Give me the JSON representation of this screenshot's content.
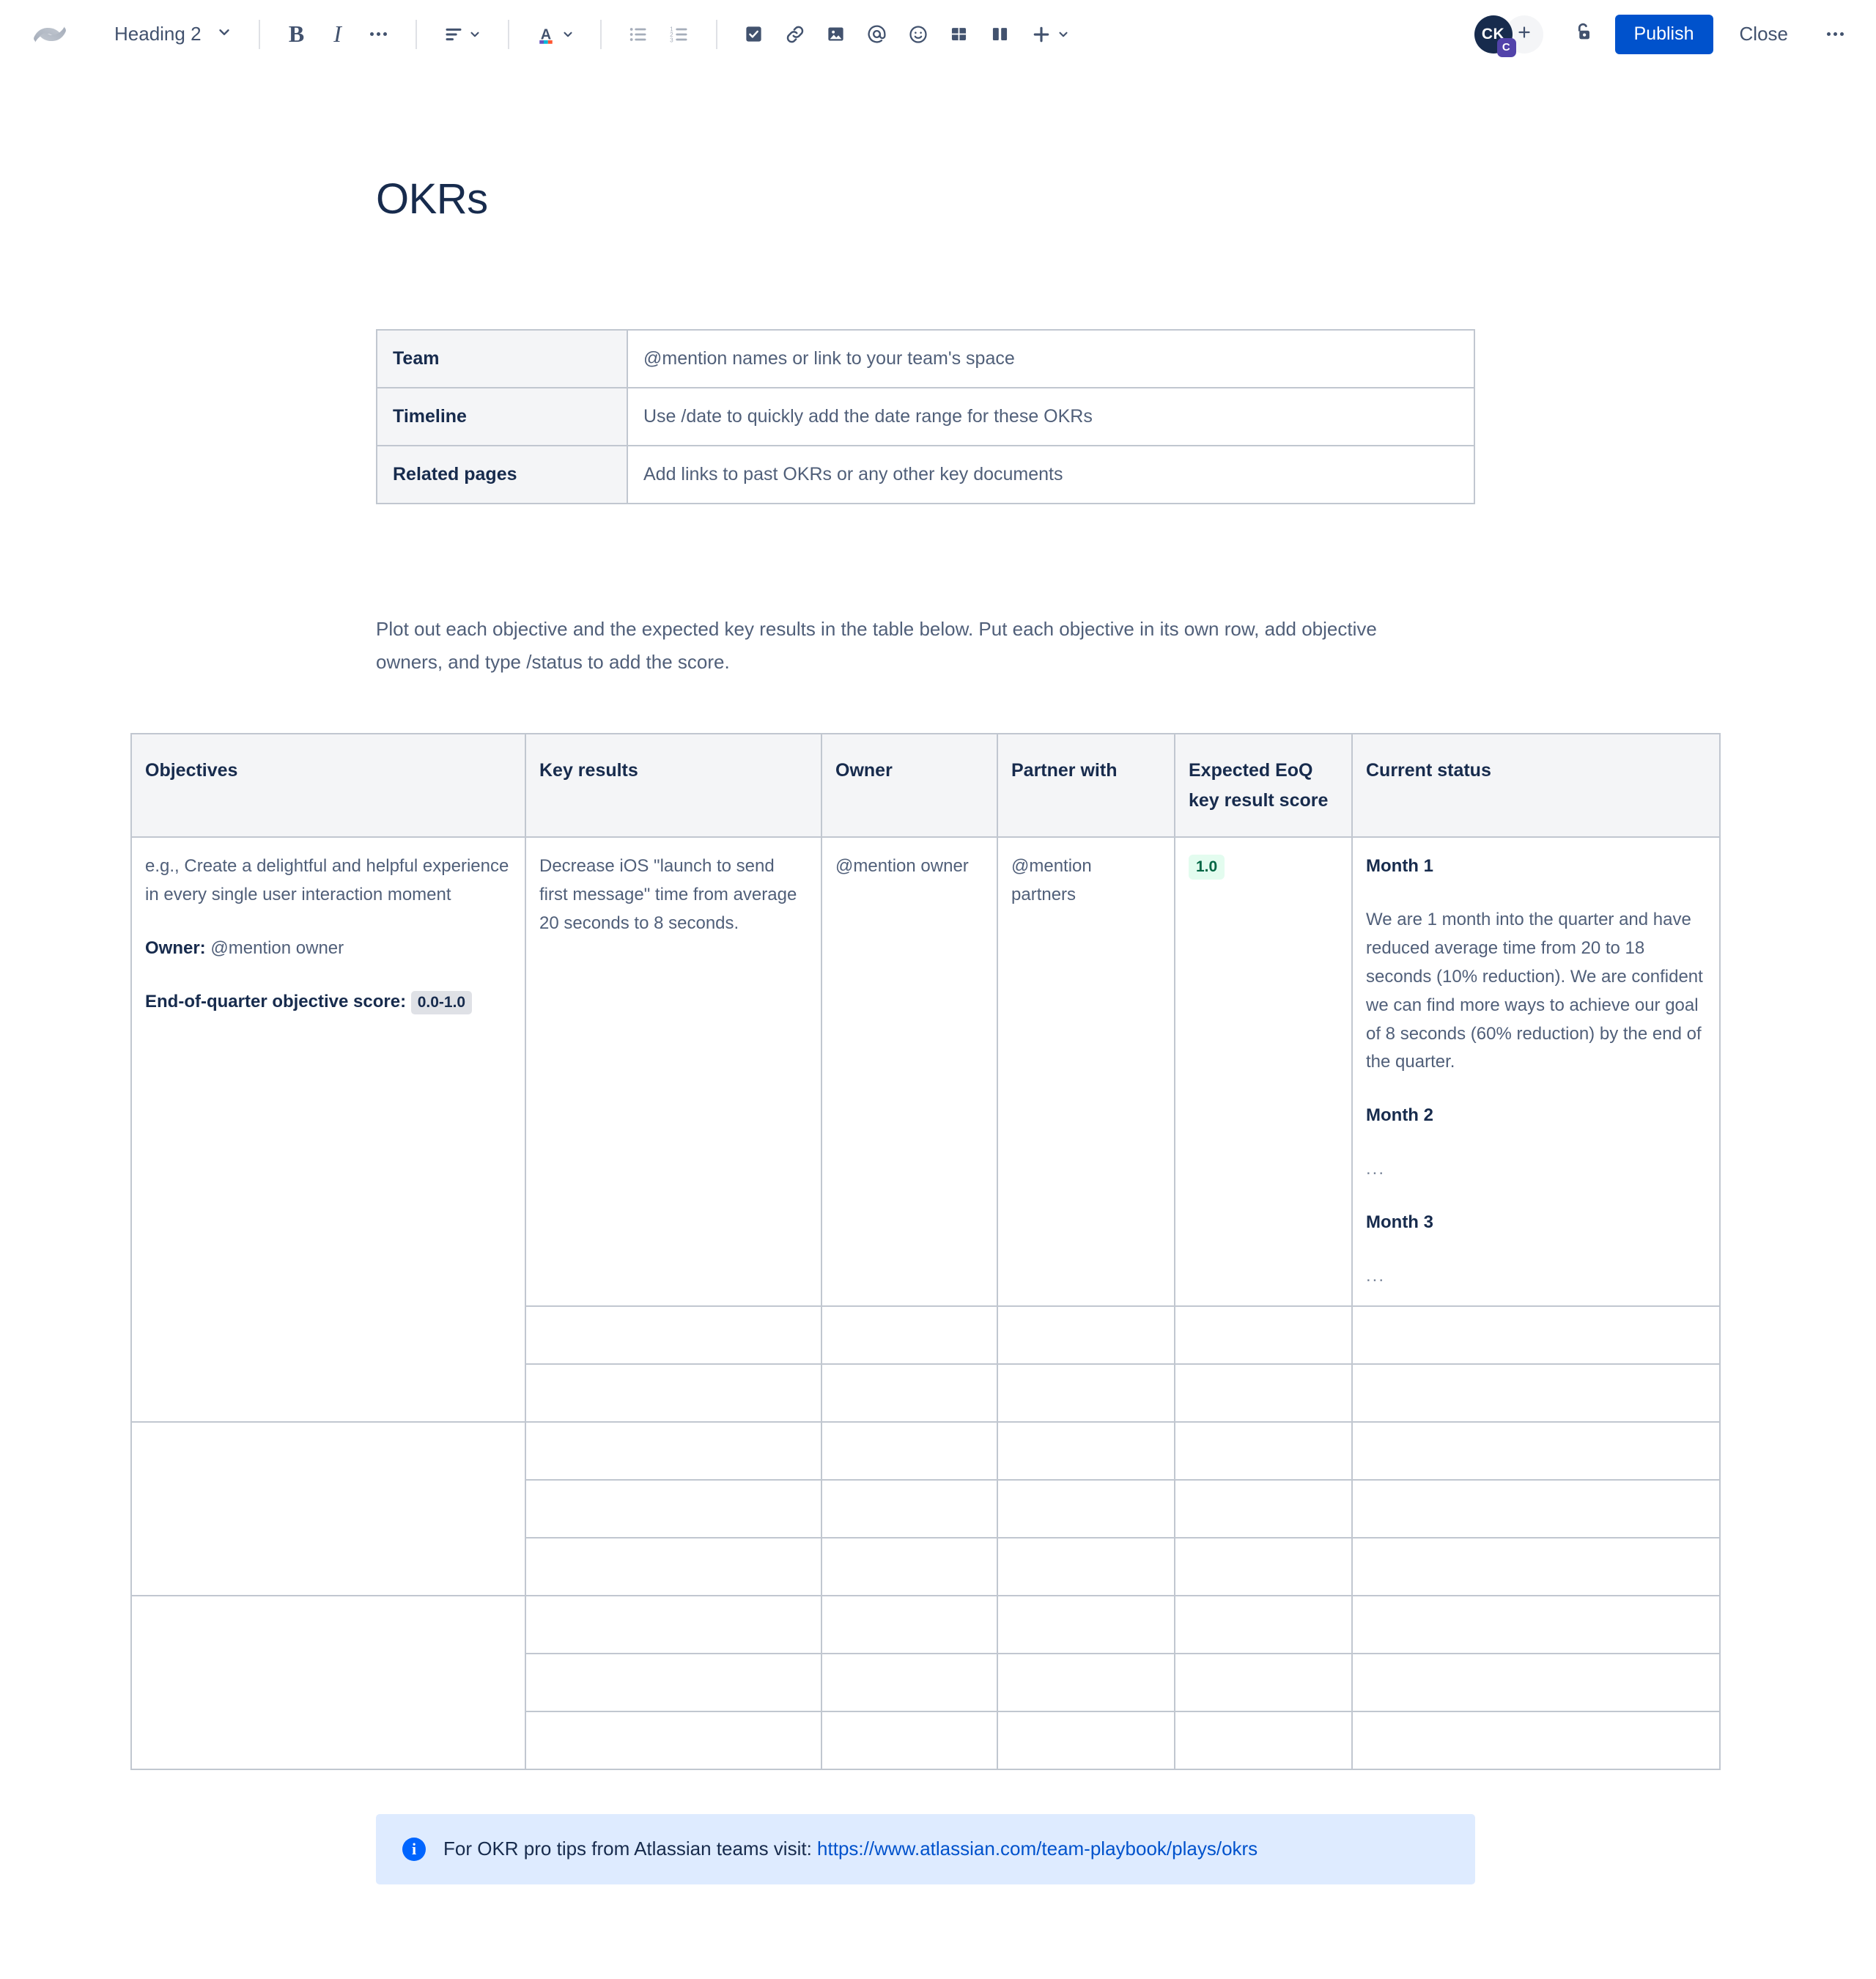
{
  "toolbar": {
    "logo_icon": "confluence-logo-icon",
    "block_type": {
      "label": "Heading 2",
      "chevron_icon": "chevron-down-icon"
    },
    "bold": {
      "label": "B",
      "name": "bold-button"
    },
    "italic": {
      "label": "I",
      "name": "italic-button"
    },
    "more_formatting_icon": "ellipsis-horizontal-icon",
    "align_icon": "text-align-left-icon",
    "text_color_icon": "text-color-a-icon",
    "bullet_list_icon": "bullet-list-icon",
    "numbered_list_icon": "numbered-list-icon",
    "task_icon": "checkbox-task-icon",
    "link_icon": "link-chain-icon",
    "image_icon": "image-picture-icon",
    "mention_icon": "at-mention-icon",
    "emoji_icon": "emoji-smiley-icon",
    "table_icon": "table-grid-icon",
    "layout_icon": "page-layout-columns-icon",
    "insert_icon": "plus-icon",
    "insert_chevron_icon": "chevron-down-icon",
    "avatar": {
      "initials": "CK",
      "badge": "C",
      "name": "user-avatar"
    },
    "add_collaborator_icon": "plus-icon",
    "restrictions_icon": "unlocked-padlock-icon",
    "publish_label": "Publish",
    "close_label": "Close",
    "more_actions_icon": "ellipsis-horizontal-icon"
  },
  "document": {
    "title": "OKRs",
    "meta_table": {
      "rows": [
        {
          "label": "Team",
          "value": "@mention names or link to your team's space"
        },
        {
          "label": "Timeline",
          "value": "Use /date to quickly add the date range for these OKRs"
        },
        {
          "label": "Related pages",
          "value": "Add links to past OKRs or any other key documents"
        }
      ]
    },
    "intro_paragraph": "Plot out each objective and the expected key results in the table below. Put each objective in its own row, add objective owners, and type /status to add the score.",
    "okr_table": {
      "headers": [
        "Objectives",
        "Key results",
        "Owner",
        "Partner with",
        "Expected EoQ key result score",
        "Current status"
      ],
      "row1": {
        "objective_text": "e.g., Create a delightful and helpful experience in every single user interaction moment",
        "owner_label": "Owner:",
        "owner_value": "@mention owner",
        "score_label": "End-of-quarter objective score:",
        "score_range_chip": "0.0-1.0",
        "key_result": "Decrease iOS \"launch to send first message\" time from average 20 seconds to 8 seconds.",
        "owner": "@mention owner",
        "partner_with": "@mention partners",
        "expected_score_chip": "1.0",
        "status": {
          "month1_heading": "Month 1",
          "month1_body": "We are 1 month into the quarter and have reduced average time from 20 to 18 seconds (10% reduction). We are confident we can find more ways to achieve our goal of 8 seconds (60% reduction) by the end of the quarter.",
          "month2_heading": "Month 2",
          "month2_body": "...",
          "month3_heading": "Month 3",
          "month3_body": "..."
        }
      }
    },
    "info_panel": {
      "icon": "info-circle-icon",
      "text": "For OKR pro tips from Atlassian teams visit: ",
      "link_text": "https://www.atlassian.com/team-playbook/plays/okrs"
    }
  },
  "colors": {
    "brand_blue": "#0052cc",
    "info_blue_bg": "#deebff",
    "score_chip_bg": "#e3fcef",
    "score_chip_text": "#006644",
    "table_border": "#c1c7d0",
    "table_header_bg": "#f4f5f7",
    "body_text": "#505f79",
    "heading_text": "#172b4d"
  }
}
